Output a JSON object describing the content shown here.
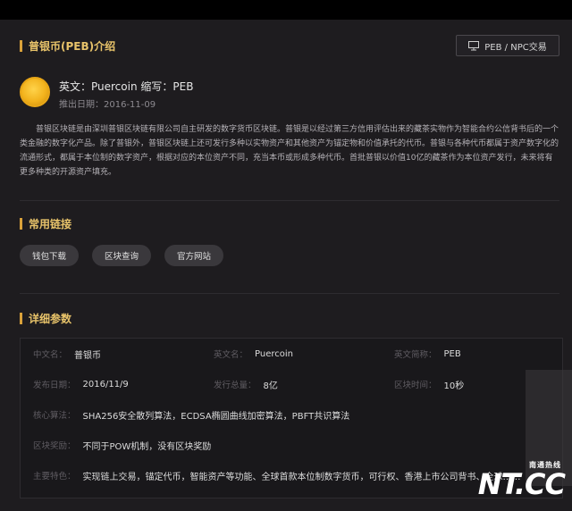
{
  "header": {
    "title": "普银币(PEB)介绍",
    "trade_button": "PEB / NPC交易"
  },
  "coin": {
    "name_line": "英文：Puercoin 缩写：PEB",
    "date_line": "推出日期：2016-11-09"
  },
  "intro": "普银区块链是由深圳普银区块链有限公司自主研发的数字货币区块链。普银是以经过第三方信用评估出来的藏茶实物作为智能合约公信背书后的一个类金融的数字化产品。除了普银外，普银区块链上还可发行多种以实物资产和其他资产为锚定物和价值承托的代币。普银与各种代币都属于资产数字化的流通形式，都属于本位制的数字资产，根据对应的本位资产不同，充当本币或形成多种代币。首批普银以价值10亿的藏茶作为本位资产发行，未来将有更多种类的开源资产填充。",
  "links_section": {
    "title": "常用链接",
    "items": [
      "钱包下载",
      "区块查询",
      "官方网站"
    ]
  },
  "params_section": {
    "title": "详细参数",
    "rows": [
      [
        {
          "label": "中文名：",
          "value": "普银币"
        },
        {
          "label": "英文名：",
          "value": "Puercoin"
        },
        {
          "label": "英文简称：",
          "value": "PEB"
        }
      ],
      [
        {
          "label": "发布日期：",
          "value": "2016/11/9"
        },
        {
          "label": "发行总量：",
          "value": "8亿"
        },
        {
          "label": "区块时间：",
          "value": "10秒"
        }
      ],
      [
        {
          "label": "核心算法：",
          "value": "SHA256安全散列算法，ECDSA椭圆曲线加密算法，PBFT共识算法"
        }
      ],
      [
        {
          "label": "区块奖励：",
          "value": "不同于POW机制，没有区块奖励"
        }
      ],
      [
        {
          "label": "主要特色：",
          "value": "实现链上交易，锚定代币，智能资产等功能、全球首款本位制数字货币，可行权、香港上市公司背书、全球……"
        }
      ]
    ]
  },
  "watermark": {
    "small": "南通热线",
    "big": "NT.CC"
  },
  "colors": {
    "accent": "#d9a13a",
    "panel_bg": "#1e1c1f",
    "pill_bg": "#3a383c"
  }
}
